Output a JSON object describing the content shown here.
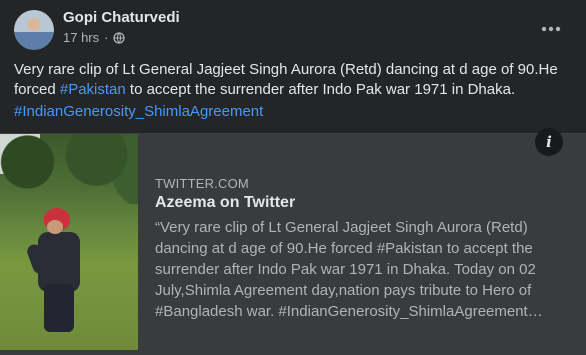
{
  "post": {
    "author": "Gopi Chaturvedi",
    "time": "17 hrs",
    "separator": "·",
    "more_icon": "more-horizontal-icon",
    "text_before": "Very rare clip of Lt General Jagjeet Singh Aurora (Retd) dancing at d age of 90.He forced ",
    "hashtag_inline": "#Pakistan",
    "text_after": " to accept the surrender after Indo Pak war 1971 in Dhaka.",
    "hashtag_line": "#IndianGenerosity_ShimlaAgreement"
  },
  "link_card": {
    "domain": "TWITTER.COM",
    "title": "Azeema on Twitter",
    "description": "“Very rare clip of Lt General Jagjeet Singh Aurora (Retd) dancing at d age of 90.He forced #Pakistan to accept the surrender after Indo Pak war 1971 in Dhaka. Today on 02 July,Shimla Agreement day,nation pays tribute to Hero of #Bangladesh war. #IndianGenerosity_ShimlaAgreement…",
    "info_label": "i"
  },
  "colors": {
    "background": "#242526",
    "card": "#3a3b3c",
    "link": "#4599ff",
    "text": "#e4e6eb",
    "muted": "#b0b3b8"
  }
}
